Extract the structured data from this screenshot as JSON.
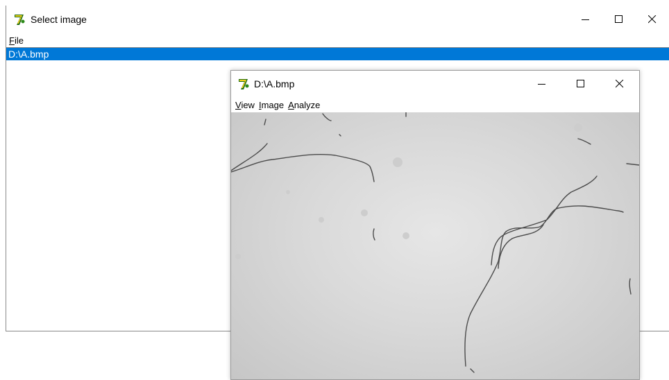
{
  "main_window": {
    "title": "Select image",
    "icon": "app-logo-icon",
    "menu": [
      {
        "label": "File",
        "accel_index": 0
      }
    ],
    "list_items": [
      "D:\\A.bmp"
    ],
    "selected_index": 0,
    "selection_color": "#0078d7"
  },
  "image_window": {
    "title": "D:\\A.bmp",
    "icon": "app-logo-icon",
    "menu": [
      {
        "label": "View",
        "accel_index": 0
      },
      {
        "label": "Image",
        "accel_index": 0
      },
      {
        "label": "Analyze",
        "accel_index": 0
      }
    ],
    "image_description": "grayscale microscope image with thin dark filaments"
  },
  "caption_buttons": [
    "minimize-icon",
    "maximize-icon",
    "close-icon"
  ]
}
